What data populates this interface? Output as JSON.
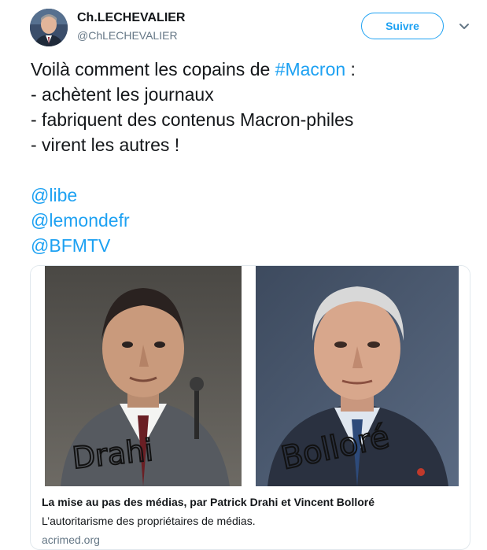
{
  "author": {
    "name": "Ch.LECHEVALIER",
    "handle": "@ChLECHEVALIER"
  },
  "follow_button": "Suivre",
  "tweet": {
    "line1_prefix": "Voilà comment les copains de ",
    "hashtag": "#Macron",
    "line1_suffix": " :",
    "line2": "- achètent les journaux",
    "line3": "- fabriquent des contenus Macron-philes",
    "line4": "- virent les autres !",
    "mentions": [
      "@libe",
      "@lemondefr",
      "@BFMTV"
    ]
  },
  "card": {
    "title": "La mise au pas des médias, par Patrick Drahi et Vincent Bolloré",
    "description": "L’autoritarisme des propriétaires de médias.",
    "domain": "acrimed.org",
    "photo_left_scrawl": "Drahi",
    "photo_right_scrawl": "Bolloré"
  },
  "colors": {
    "link": "#1da1f2",
    "text": "#14171a",
    "muted": "#657786",
    "border": "#e1e8ed"
  },
  "icons": [
    "chevron-down-icon"
  ]
}
